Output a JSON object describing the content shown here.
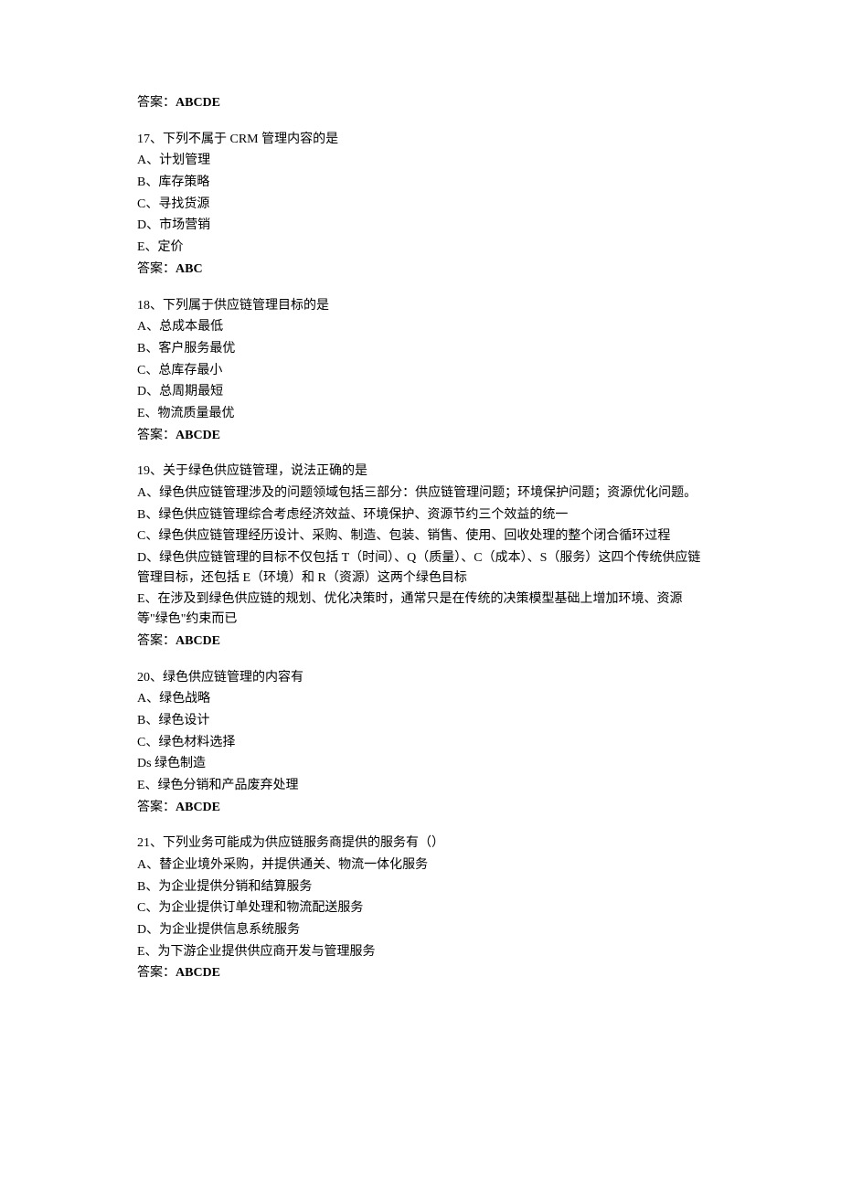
{
  "answer_label": "答案：",
  "questions": [
    {
      "pre_answer": "ABCDE",
      "number": "17、",
      "stem": "下列不属于 CRM 管理内容的是",
      "options": [
        "A、计划管理",
        "B、库存策略",
        "C、寻找货源",
        "D、市场营销",
        "E、定价"
      ],
      "answer": "ABC"
    },
    {
      "number": "18、",
      "stem": "下列属于供应链管理目标的是",
      "options": [
        "A、总成本最低",
        "B、客户服务最优",
        "C、总库存最小",
        "D、总周期最短",
        "E、物流质量最优"
      ],
      "answer": "ABCDE"
    },
    {
      "number": "19、",
      "stem": "关于绿色供应链管理，说法正确的是",
      "options": [
        "A、绿色供应链管理涉及的问题领域包括三部分：供应链管理问题；环境保护问题；资源优化问题。",
        "B、绿色供应链管理综合考虑经济效益、环境保护、资源节约三个效益的统一",
        "C、绿色供应链管理经历设计、采购、制造、包装、销售、使用、回收处理的整个闭合循环过程",
        "D、绿色供应链管理的目标不仅包括 T（时间）、Q（质量）、C（成本）、S（服务）这四个传统供应链管理目标，还包括 E（环境）和 R（资源）这两个绿色目标",
        "E、在涉及到绿色供应链的规划、优化决策时，通常只是在传统的决策模型基础上增加环境、资源等\"绿色\"约束而已"
      ],
      "answer": "ABCDE"
    },
    {
      "number": "20、",
      "stem": "绿色供应链管理的内容有",
      "options": [
        "A、绿色战略",
        "B、绿色设计",
        "C、绿色材料选择",
        "Ds 绿色制造",
        "E、绿色分销和产品废弃处理"
      ],
      "answer": "ABCDE"
    },
    {
      "number": "21、",
      "stem": "下列业务可能成为供应链服务商提供的服务有（）",
      "options": [
        "A、替企业境外采购，并提供通关、物流一体化服务",
        "B、为企业提供分销和结算服务",
        "C、为企业提供订单处理和物流配送服务",
        "D、为企业提供信息系统服务",
        "E、为下游企业提供供应商开发与管理服务"
      ],
      "answer": "ABCDE"
    }
  ]
}
